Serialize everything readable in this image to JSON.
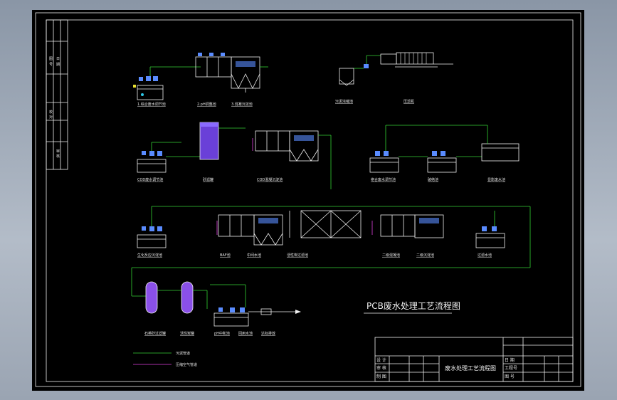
{
  "drawing": {
    "title": "PCB废水处理工艺流程图",
    "title_block_name": "废水处理工艺流程图",
    "legend": [
      {
        "label": "污泥管道",
        "color": "#34d234"
      },
      {
        "label": "压缩空气管道",
        "color": "#e040e0"
      }
    ],
    "left_strip": [
      "图",
      "号",
      "日",
      "期",
      "校",
      "对",
      "审",
      "核"
    ],
    "title_block_cells": [
      "设 计",
      "审 核",
      "制 图",
      "日 期",
      "工程号",
      "图 号"
    ],
    "units": {
      "u1": "1.综合废水调节池",
      "u2": "2.pH调整池",
      "u3": "3.混凝沉淀池",
      "u4": "污泥浓缩池",
      "u5": "压滤机",
      "u6": "COD废水调节池",
      "u7": "砂滤罐",
      "u8": "COD混凝沉淀池",
      "u9": "络合废水调节池",
      "u10": "破络池",
      "u11": "显影废水池",
      "u12": "生化反应沉淀池",
      "u13": "BAF池",
      "u14": "中间水池",
      "u15": "活性炭过滤池",
      "u16": "二级混凝池",
      "u17": "二级沉淀池",
      "u18": "过滤水池",
      "u19": "石英砂过滤罐",
      "u20": "活性炭罐",
      "u21": "pH中和池",
      "u22": "回用水池",
      "u23": "达标排放"
    }
  }
}
